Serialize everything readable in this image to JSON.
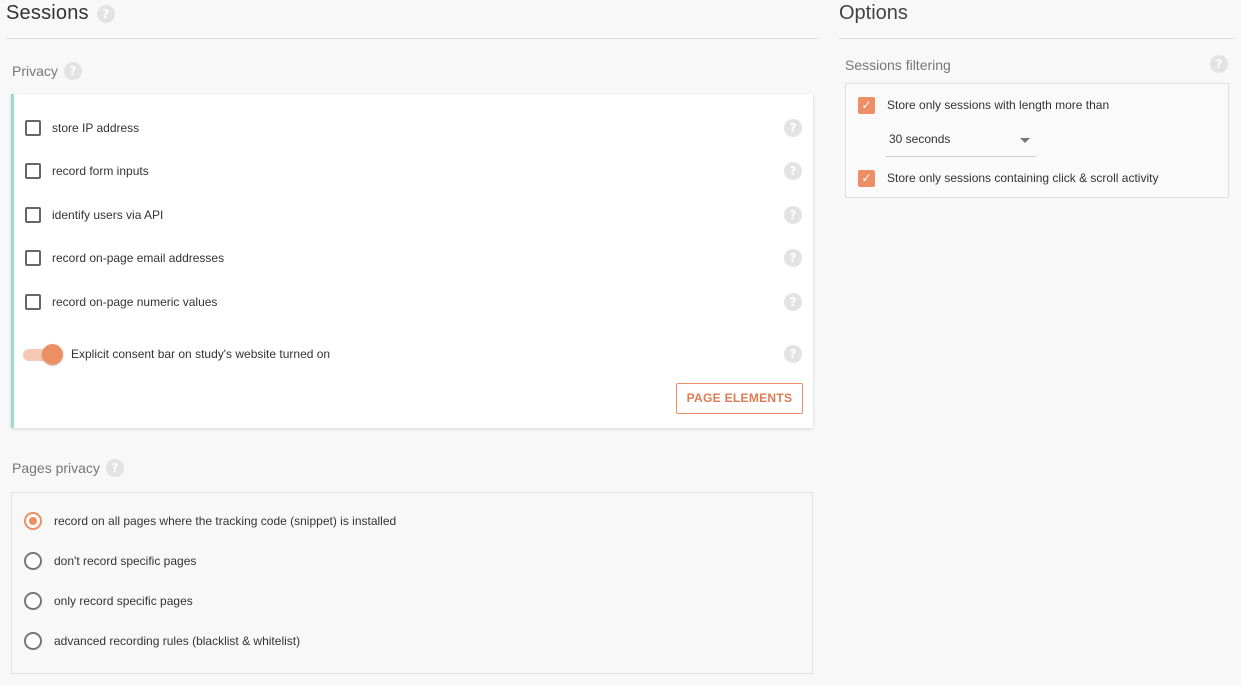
{
  "sessions": {
    "title": "Sessions",
    "privacy": {
      "title": "Privacy",
      "items": [
        {
          "label": "store IP address",
          "checked": false
        },
        {
          "label": "record form inputs",
          "checked": false
        },
        {
          "label": "identify users via API",
          "checked": false
        },
        {
          "label": "record on-page email addresses",
          "checked": false
        },
        {
          "label": "record on-page numeric values",
          "checked": false
        }
      ],
      "consent_toggle": {
        "label": "Explicit consent bar on study's website turned on",
        "on": true
      },
      "page_elements_button": "PAGE ELEMENTS"
    },
    "pages_privacy": {
      "title": "Pages privacy",
      "options": [
        {
          "label": "record on all pages where the tracking code (snippet) is installed",
          "selected": true
        },
        {
          "label": "don't record specific pages",
          "selected": false
        },
        {
          "label": "only record specific pages",
          "selected": false
        },
        {
          "label": "advanced recording rules (blacklist & whitelist)",
          "selected": false
        }
      ]
    }
  },
  "options": {
    "title": "Options",
    "sessions_filtering": {
      "title": "Sessions filtering",
      "min_length_label": "Store only sessions with length more than",
      "min_length_checked": true,
      "min_length_value": "30 seconds",
      "activity_label": "Store only sessions containing click & scroll activity",
      "activity_checked": true
    }
  },
  "colors": {
    "accent": "#ed8f64",
    "teal_border": "#9fd8d0"
  },
  "icons": {
    "help": "question-circle-icon",
    "check": "checkmark-icon",
    "dropdown": "triangle-down-icon"
  }
}
